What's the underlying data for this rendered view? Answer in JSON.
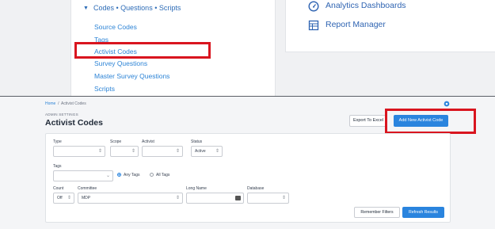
{
  "menu": {
    "header": "Codes • Questions • Scripts",
    "items": [
      {
        "label": "Source Codes"
      },
      {
        "label": "Tags"
      },
      {
        "label": "Activist Codes"
      },
      {
        "label": "Survey Questions"
      },
      {
        "label": "Master Survey Questions"
      },
      {
        "label": "Scripts"
      }
    ]
  },
  "right_menu": {
    "items": [
      {
        "label": "Analytics Dashboards",
        "icon": "dashboard-gauge-icon"
      },
      {
        "label": "Report Manager",
        "icon": "report-table-icon"
      }
    ]
  },
  "breadcrumb": {
    "home": "Home",
    "separator": "/",
    "current": "Activist Codes"
  },
  "page": {
    "eyebrow": "ADMIN SETTINGS",
    "title": "Activist Codes",
    "export_label": "Export To Excel",
    "add_label": "Add New Activist Code"
  },
  "filters": {
    "type": {
      "label": "Type",
      "value": ""
    },
    "scope": {
      "label": "Scope",
      "value": ""
    },
    "activist": {
      "label": "Activist",
      "value": ""
    },
    "status": {
      "label": "Status",
      "value": "Active"
    },
    "tags": {
      "label": "Tags",
      "value": "",
      "any_label": "Any Tags",
      "all_label": "All Tags",
      "selected": "Any Tags"
    },
    "count": {
      "label": "Count",
      "value": "Off"
    },
    "committee": {
      "label": "Committee",
      "value": "MDP"
    },
    "long_name": {
      "label": "Long Name",
      "value": ""
    },
    "database": {
      "label": "Database",
      "value": ""
    }
  },
  "actions": {
    "remember_label": "Remember Filters",
    "refresh_label": "Refresh Results"
  },
  "colors": {
    "accent": "#2a84de",
    "link": "#2d84d6",
    "highlight": "#d9151f"
  }
}
